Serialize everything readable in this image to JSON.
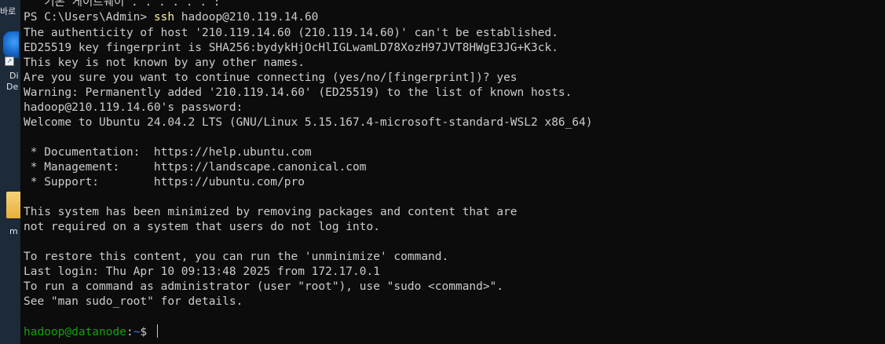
{
  "desktop": {
    "label_1": "바로",
    "label_2": "Di",
    "label_3": "De",
    "label_4": "m"
  },
  "terminal": {
    "top_partial_line": "   기본 게이트웨이 . . . . . . :",
    "ps_prompt": "PS C:\\Users\\Admin> ",
    "ssh_command": "ssh",
    "ssh_args": " hadoop@210.119.14.60",
    "lines": [
      "The authenticity of host '210.119.14.60 (210.119.14.60)' can't be established.",
      "ED25519 key fingerprint is SHA256:bydykHjOcHlIGLwamLD78XozH97JVT8HWgE3JG+K3ck.",
      "This key is not known by any other names.",
      "Are you sure you want to continue connecting (yes/no/[fingerprint])? yes",
      "Warning: Permanently added '210.119.14.60' (ED25519) to the list of known hosts.",
      "hadoop@210.119.14.60's password:",
      "Welcome to Ubuntu 24.04.2 LTS (GNU/Linux 5.15.167.4-microsoft-standard-WSL2 x86_64)",
      "",
      " * Documentation:  https://help.ubuntu.com",
      " * Management:     https://landscape.canonical.com",
      " * Support:        https://ubuntu.com/pro",
      "",
      "This system has been minimized by removing packages and content that are",
      "not required on a system that users do not log into.",
      "",
      "To restore this content, you can run the 'unminimize' command.",
      "Last login: Thu Apr 10 09:13:48 2025 from 172.17.0.1",
      "To run a command as administrator (user \"root\"), use \"sudo <command>\".",
      "See \"man sudo_root\" for details.",
      ""
    ],
    "final_prompt": {
      "user_host": "hadoop@datanode",
      "separator": ":",
      "path": "~",
      "symbol": "$ "
    }
  },
  "colors": {
    "background": "#0c0c0c",
    "text": "#cccccc",
    "command": "#f9f1a5",
    "prompt_user": "#13a10e",
    "prompt_path": "#3b78ff"
  }
}
